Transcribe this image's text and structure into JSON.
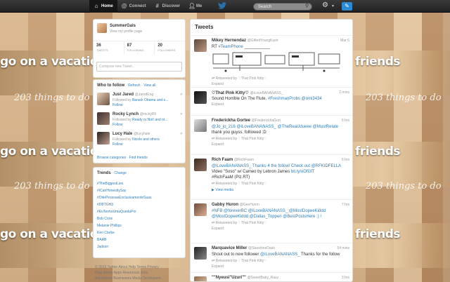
{
  "topbar": {
    "home": "Home",
    "connect": "Connect",
    "discover": "Discover",
    "me": "Me",
    "search_placeholder": "Search"
  },
  "background": {
    "caption": "go on a vacation with",
    "caption_right": "friends",
    "script": "203 things to do"
  },
  "profile": {
    "name": "SummerGals",
    "view_profile": "View my profile page",
    "tweets_count": "36",
    "tweets_label": "TWEETS",
    "following_count": "87",
    "following_label": "FOLLOWING",
    "followers_count": "20",
    "followers_label": "FOLLOWERS",
    "compose_placeholder": "Compose new Tweet..."
  },
  "who_to_follow": {
    "title": "Who to follow",
    "refresh": "Refresh",
    "view_all": "View all",
    "suggestions": [
      {
        "name": "Just Jared",
        "handle": "@JaredEng",
        "followed_by_prefix": "Followed by ",
        "followed_by": "Barack Obama and o...",
        "follow": "Follow"
      },
      {
        "name": "Rocky Lynch",
        "handle": "@rockyR5",
        "followed_by_prefix": "Followed by ",
        "followed_by": "Ready or Not! and ot...",
        "follow": "Follow"
      },
      {
        "name": "Lucy Hale",
        "handle": "@lucyhale",
        "followed_by_prefix": "Followed by ",
        "followed_by": "Nicole and others",
        "follow": "Follow"
      }
    ],
    "browse": "Browse categories",
    "find_friends": "Find friends"
  },
  "trends": {
    "title": "Trends",
    "change": "Change",
    "items": [
      "#TheBiggestLies",
      "#ICanHonestlySay",
      "#OitePessoasExclusivamenteSuas",
      "#DBTGH3",
      "#EuTenhoUmaQuedaPor",
      "Bob Crow",
      "Melanie Phillips",
      "Ken Clarke",
      "BAAB",
      "Jadson"
    ]
  },
  "footer": {
    "line1": "© 2013 Twitter  About  Help  Terms  Privacy",
    "line2": "Blog  Status  Apps  Resources  Jobs",
    "line3": "Advertisers  Businesses  Media  Developers"
  },
  "stream": {
    "title": "Tweets",
    "tweets": [
      {
        "name": "Mikey Hernendaz",
        "handle": "@GiftedYoungKush",
        "time": "Mar 6",
        "text_prefix": "RT ",
        "text_link": "#TeamPhone",
        "text_rest": " ___________",
        "retweeted": "Retweeted by ♡That Pink Kitty♡",
        "expand": "Expand"
      },
      {
        "name": "♡That Pink Kitty♡",
        "handle": "@iLoveBANANASS_",
        "time": "2 mins",
        "text_prefix": "Sound Horrible On The Flute. ",
        "text_link": "#FreshmanProbs",
        "text_rest": " @omi3434",
        "expand": "Expand"
      },
      {
        "name": "Frederickha Gortee",
        "handle": "@FrederickhaGort",
        "time": "6 hrs",
        "text_prefix": "@Jo_jo_216 @iLoveBANANASS_ @TheRealJdueee @MustRelate",
        "text_link": "",
        "text_rest": "thank you guyss. folllowed :D",
        "retweeted": "Retweeted by ♡That Pink Kitty♡",
        "expand": "Expand"
      },
      {
        "name": "Rich Faam",
        "handle": "@RichFaam",
        "time": "6 hrs",
        "text_prefix": "@iLoveBANANASS_ Thanks 4 the follow! Check out @RFKIDFELLA",
        "text_link": "bit.ly/oOfGfT",
        "text_rest": "Video \"Soso\" w/ Cameo by Lebron James",
        "extra": "#RichFaaM (Plz.RT)",
        "retweeted": "Retweeted by ♡That Pink Kitty♡",
        "view_media": "View media"
      },
      {
        "name": "Gabby Huron",
        "handle": "@GeeHuron",
        "time": "7 hrs",
        "text_prefix": "#NFB @foreverBC @iLoveBANANASS_ @MostDopeeKiddd",
        "text_link": "",
        "text_rest": "@MostDopeeKiddd @Dallas_Toppen @BestPostsHere :) !",
        "retweeted": "Retweeted by ♡That Pink Kitty♡",
        "expand": "Expand"
      },
      {
        "name": "Marquavice Miller",
        "handle": "@StarshineDash",
        "time": "54 mins",
        "text_prefix": "Shout out to new follower ",
        "text_link": "@iLoveBANANASS_",
        "text_rest": " Thanks for the follow",
        "retweeted": "Retweeted by ♡That Pink Kitty♡",
        "expand": "Expand"
      },
      {
        "name": "\"\"Nyeusi\"Uzuri\"\"",
        "handle": "@SweetBaby_Rasy",
        "time": "3 hrs",
        "text_prefix": "",
        "text_link": "",
        "text_rest": ""
      }
    ]
  },
  "colors": {
    "link": "#2f7eb8",
    "topbar": "#222222",
    "compose_button": "#2d8ad2"
  }
}
